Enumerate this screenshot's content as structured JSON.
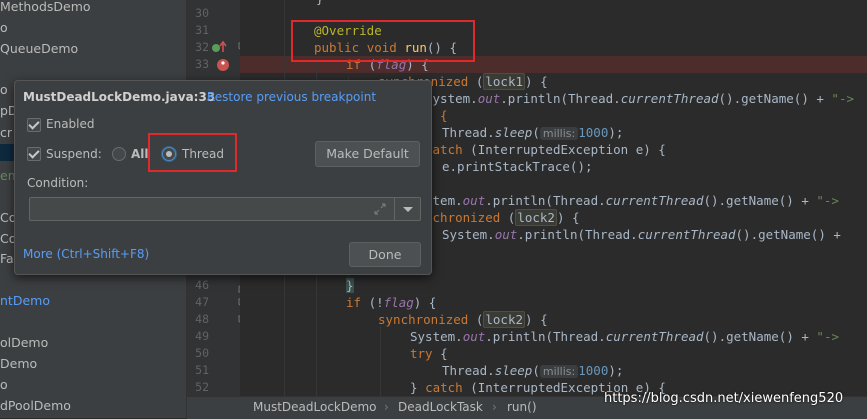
{
  "sidebar": {
    "items": [
      {
        "label": "MethodsDemo",
        "style": "normal"
      },
      {
        "label": "o",
        "style": "normal"
      },
      {
        "label": "QueueDemo",
        "style": "normal"
      },
      {
        "label": "o",
        "style": "normal"
      },
      {
        "label": "pD",
        "style": "normal"
      },
      {
        "label": "cr",
        "style": "normal"
      },
      {
        "label": "",
        "style": "sel"
      },
      {
        "label": "em",
        "style": "green"
      },
      {
        "label": "Co",
        "style": "normal"
      },
      {
        "label": "Co",
        "style": "normal"
      },
      {
        "label": "Fai",
        "style": "normal"
      },
      {
        "label": "ntDemo",
        "style": "blue"
      },
      {
        "label": "olDemo",
        "style": "normal"
      },
      {
        "label": "Demo",
        "style": "normal"
      },
      {
        "label": "o",
        "style": "normal"
      },
      {
        "label": "dPoolDemo",
        "style": "normal"
      }
    ]
  },
  "gutter": {
    "line_numbers": [
      "30",
      "31",
      "32",
      "33",
      "46",
      "47",
      "48",
      "49",
      "50",
      "51",
      "52"
    ]
  },
  "code": {
    "l30": "}",
    "l31_ann": "@Override",
    "l32_kw1": "public",
    "l32_kw2": "void",
    "l32_fn": "run",
    "l32_rest": "() {",
    "l33_kw": "if",
    "l33_open": " (",
    "l33_fld": "flag",
    "l33_close": ") {",
    "sync1_kw": "synchronized",
    "sync1_open": " (",
    "sync1_lock": "lock1",
    "sync1_close": ") {",
    "println1_a": "System.",
    "println1_out": "out",
    "println1_b": ".println(Thread.",
    "println1_ct": "currentThread",
    "println1_c": "().getName() + ",
    "println1_str": "\"->",
    "try1": "y {",
    "sleep1_a": "Thread.",
    "sleep1_m": "sleep",
    "sleep1_open": "(",
    "sleep1_hint": "millis:",
    "sleep1_num": "1000",
    "sleep1_close": ");",
    "catch1_kw": "catch",
    "catch1_rest": " (InterruptedException e) {",
    "stack1": "e.printStackTrace();",
    "println2_a": "stem.",
    "println2_out": "out",
    "println2_b": ".println(Thread.",
    "println2_ct": "currentThread",
    "println2_c": "().getName() + ",
    "println2_str": "\"->",
    "sync2_kw": "nchronized",
    "sync2_open": " (",
    "sync2_lock": "lock2",
    "sync2_close": ") {",
    "println3_a": "System.",
    "println3_out": "out",
    "println3_b": ".println(Thread.",
    "println3_ct": "currentThread",
    "println3_c": "().getName() +",
    "l46": "}",
    "l47_kw": "if",
    "l47_rest": " (!",
    "l47_fld": "flag",
    "l47_close": ") {",
    "l48_kw": "synchronized",
    "l48_open": " (",
    "l48_lock": "lock2",
    "l48_close": ") {",
    "l49_a": "System.",
    "l49_out": "out",
    "l49_b": ".println(Thread.",
    "l49_ct": "currentThread",
    "l49_c": "().getName() + ",
    "l49_str": "\"->",
    "l50_kw": "try",
    "l50_rest": " {",
    "l51_a": "Thread.",
    "l51_m": "sleep",
    "l51_open": "(",
    "l51_hint": "millis:",
    "l51_num": "1000",
    "l51_close": ");",
    "l52_a": "} ",
    "l52_kw": "catch",
    "l52_rest": " (InterruptedException e) {"
  },
  "popup": {
    "title": "MustDeadLockDemo.java:33",
    "restore_link": "Restore previous breakpoint",
    "enabled_label": "Enabled",
    "enabled_checked": true,
    "suspend_label": "Suspend:",
    "suspend_checked": true,
    "radio_all": "All",
    "radio_thread": "Thread",
    "selected_radio": "Thread",
    "make_default": "Make Default",
    "condition_label": "Condition:",
    "condition_value": "",
    "more_link": "More (Ctrl+Shift+F8)",
    "done": "Done"
  },
  "breadcrumb": {
    "items": [
      "MustDeadLockDemo",
      "DeadLockTask",
      "run()"
    ]
  },
  "watermark": "https://blog.csdn.net/xiewenfeng520",
  "colors": {
    "accent_red": "#e0292b",
    "keyword": "#cc7832",
    "annotation": "#bbb529",
    "link": "#589df6"
  }
}
